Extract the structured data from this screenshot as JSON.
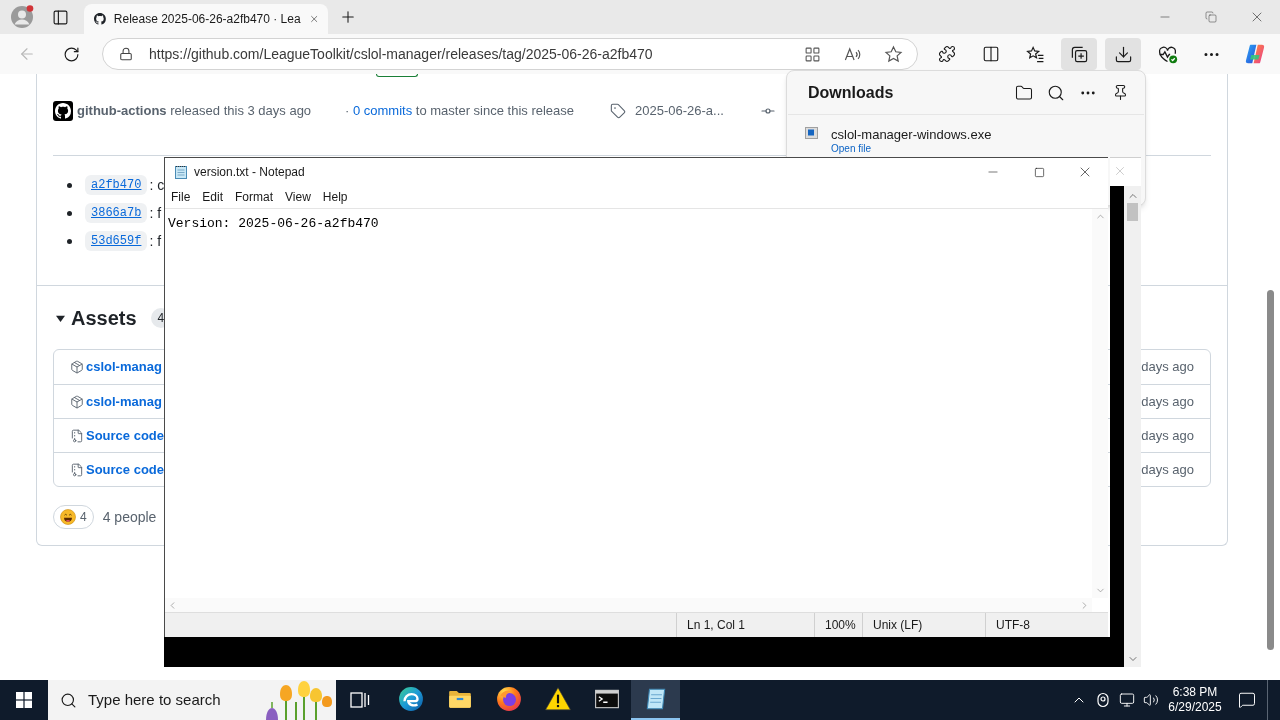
{
  "browser": {
    "tabs": [
      {
        "title": "Release 2025-06-26-a2fb470 · Lea",
        "selected": true
      }
    ],
    "back": {
      "disabled": true
    },
    "address": {
      "url": "https://github.com/LeagueToolkit/cslol-manager/releases/tag/2025-06-26-a2fb470"
    },
    "toolbar": [
      {
        "selected": false
      },
      {
        "selected": false
      },
      {
        "selected": false
      },
      {
        "selected": true
      },
      {
        "selected": true
      },
      {
        "selected": false
      },
      {
        "selected": false
      },
      {
        "selected": false
      }
    ]
  },
  "release": {
    "author": "github-actions",
    "released": "released this 3 days ago",
    "commits_note": {
      "prefix": "·",
      "link": "0 commits",
      "suffix": "to master since this release"
    },
    "tag": "2025-06-26-a...",
    "commits": [
      {
        "sha": "a2fb470",
        "message": ": c"
      },
      {
        "sha": "3866a7b",
        "message": ": f"
      },
      {
        "sha": "53d659f",
        "message": ": f"
      }
    ],
    "assets": {
      "title": "Assets",
      "expanded": true,
      "count": "4",
      "rows": [
        {
          "kind": "package",
          "name": "cslol-manag",
          "date": "days ago"
        },
        {
          "kind": "package",
          "name": "cslol-manag",
          "date": "days ago"
        },
        {
          "kind": "archive",
          "name": "Source code",
          "date": "days ago"
        },
        {
          "kind": "archive",
          "name": "Source code",
          "date": "days ago"
        }
      ]
    },
    "reactions": {
      "count": "4",
      "summary": "4 people"
    }
  },
  "downloads": {
    "title": "Downloads",
    "items": [
      {
        "name": "cslol-manager-windows.exe",
        "action": "Open file"
      }
    ]
  },
  "notepad": {
    "title": "version.txt - Notepad",
    "menu": [
      "File",
      "Edit",
      "Format",
      "View",
      "Help"
    ],
    "content": "Version: 2025-06-26-a2fb470",
    "status": [
      "Ln 1, Col 1",
      "100%",
      "Unix (LF)",
      "UTF-8"
    ]
  },
  "taskbar": {
    "search": {
      "placeholder": "Type here to search"
    },
    "apps": [
      {
        "selected": false
      },
      {
        "selected": false
      },
      {
        "selected": false
      },
      {
        "selected": false
      },
      {
        "selected": false
      },
      {
        "selected": true
      }
    ],
    "time": "6:38 PM",
    "date": "6/29/2025"
  }
}
